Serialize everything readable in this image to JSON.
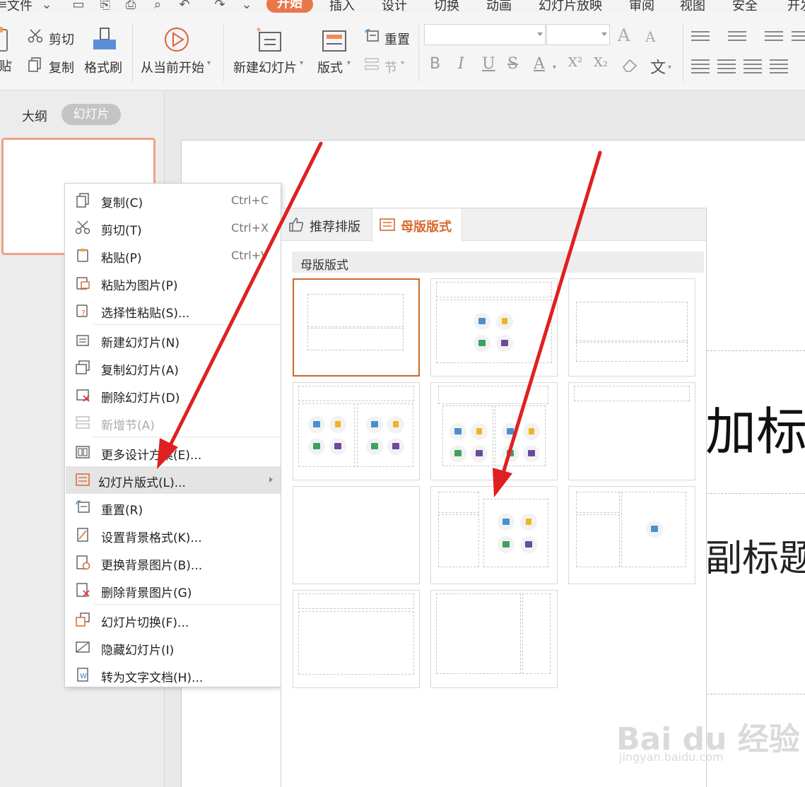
{
  "menubar": {
    "file": "文件",
    "tabs": [
      "开始",
      "插入",
      "设计",
      "切换",
      "动画",
      "幻灯片放映",
      "审阅",
      "视图",
      "安全",
      "开发"
    ]
  },
  "ribbon": {
    "paste_partial": "贴",
    "cut": "剪切",
    "copy": "复制",
    "format_painter": "格式刷",
    "from_current": "从当前开始",
    "new_slide": "新建幻灯片",
    "layout": "版式",
    "reset": "重置",
    "section": "节",
    "font_grow": "A",
    "font_shrink": "A",
    "bold": "B",
    "italic": "I",
    "underline": "U",
    "strike": "S",
    "font_color": "A",
    "superscript": "X²",
    "subscript": "X₂",
    "wen": "文"
  },
  "leftpane": {
    "outline_tab": "大纲",
    "slides_tab": "幻灯片"
  },
  "slide": {
    "title_partial": "加标题",
    "subtitle_partial": "副标题"
  },
  "context_menu": {
    "items": [
      {
        "label": "复制(C)",
        "shortcut": "Ctrl+C"
      },
      {
        "label": "剪切(T)",
        "shortcut": "Ctrl+X"
      },
      {
        "label": "粘贴(P)",
        "shortcut": "Ctrl+V"
      },
      {
        "label": "粘贴为图片(P)",
        "shortcut": ""
      },
      {
        "label": "选择性粘贴(S)...",
        "shortcut": ""
      },
      {
        "label": "新建幻灯片(N)",
        "shortcut": ""
      },
      {
        "label": "复制幻灯片(A)",
        "shortcut": ""
      },
      {
        "label": "删除幻灯片(D)",
        "shortcut": ""
      },
      {
        "label": "新增节(A)",
        "shortcut": ""
      },
      {
        "label": "更多设计方案(E)...",
        "shortcut": ""
      },
      {
        "label": "幻灯片版式(L)...",
        "shortcut": ""
      },
      {
        "label": "重置(R)",
        "shortcut": ""
      },
      {
        "label": "设置背景格式(K)...",
        "shortcut": ""
      },
      {
        "label": "更换背景图片(B)...",
        "shortcut": ""
      },
      {
        "label": "删除背景图片(G)",
        "shortcut": ""
      },
      {
        "label": "幻灯片切换(F)...",
        "shortcut": ""
      },
      {
        "label": "隐藏幻灯片(I)",
        "shortcut": ""
      },
      {
        "label": "转为文字文档(H)...",
        "shortcut": ""
      }
    ]
  },
  "layout_panel": {
    "tab_recommended": "推荐排版",
    "tab_master": "母版版式",
    "section_title": "母版版式"
  },
  "watermark": {
    "brand": "Bai du 经验",
    "url": "jingyan.baidu.com"
  },
  "colors": {
    "accent": "#e8774a",
    "selected_border": "#c8692d",
    "arrow": "#e02020"
  }
}
